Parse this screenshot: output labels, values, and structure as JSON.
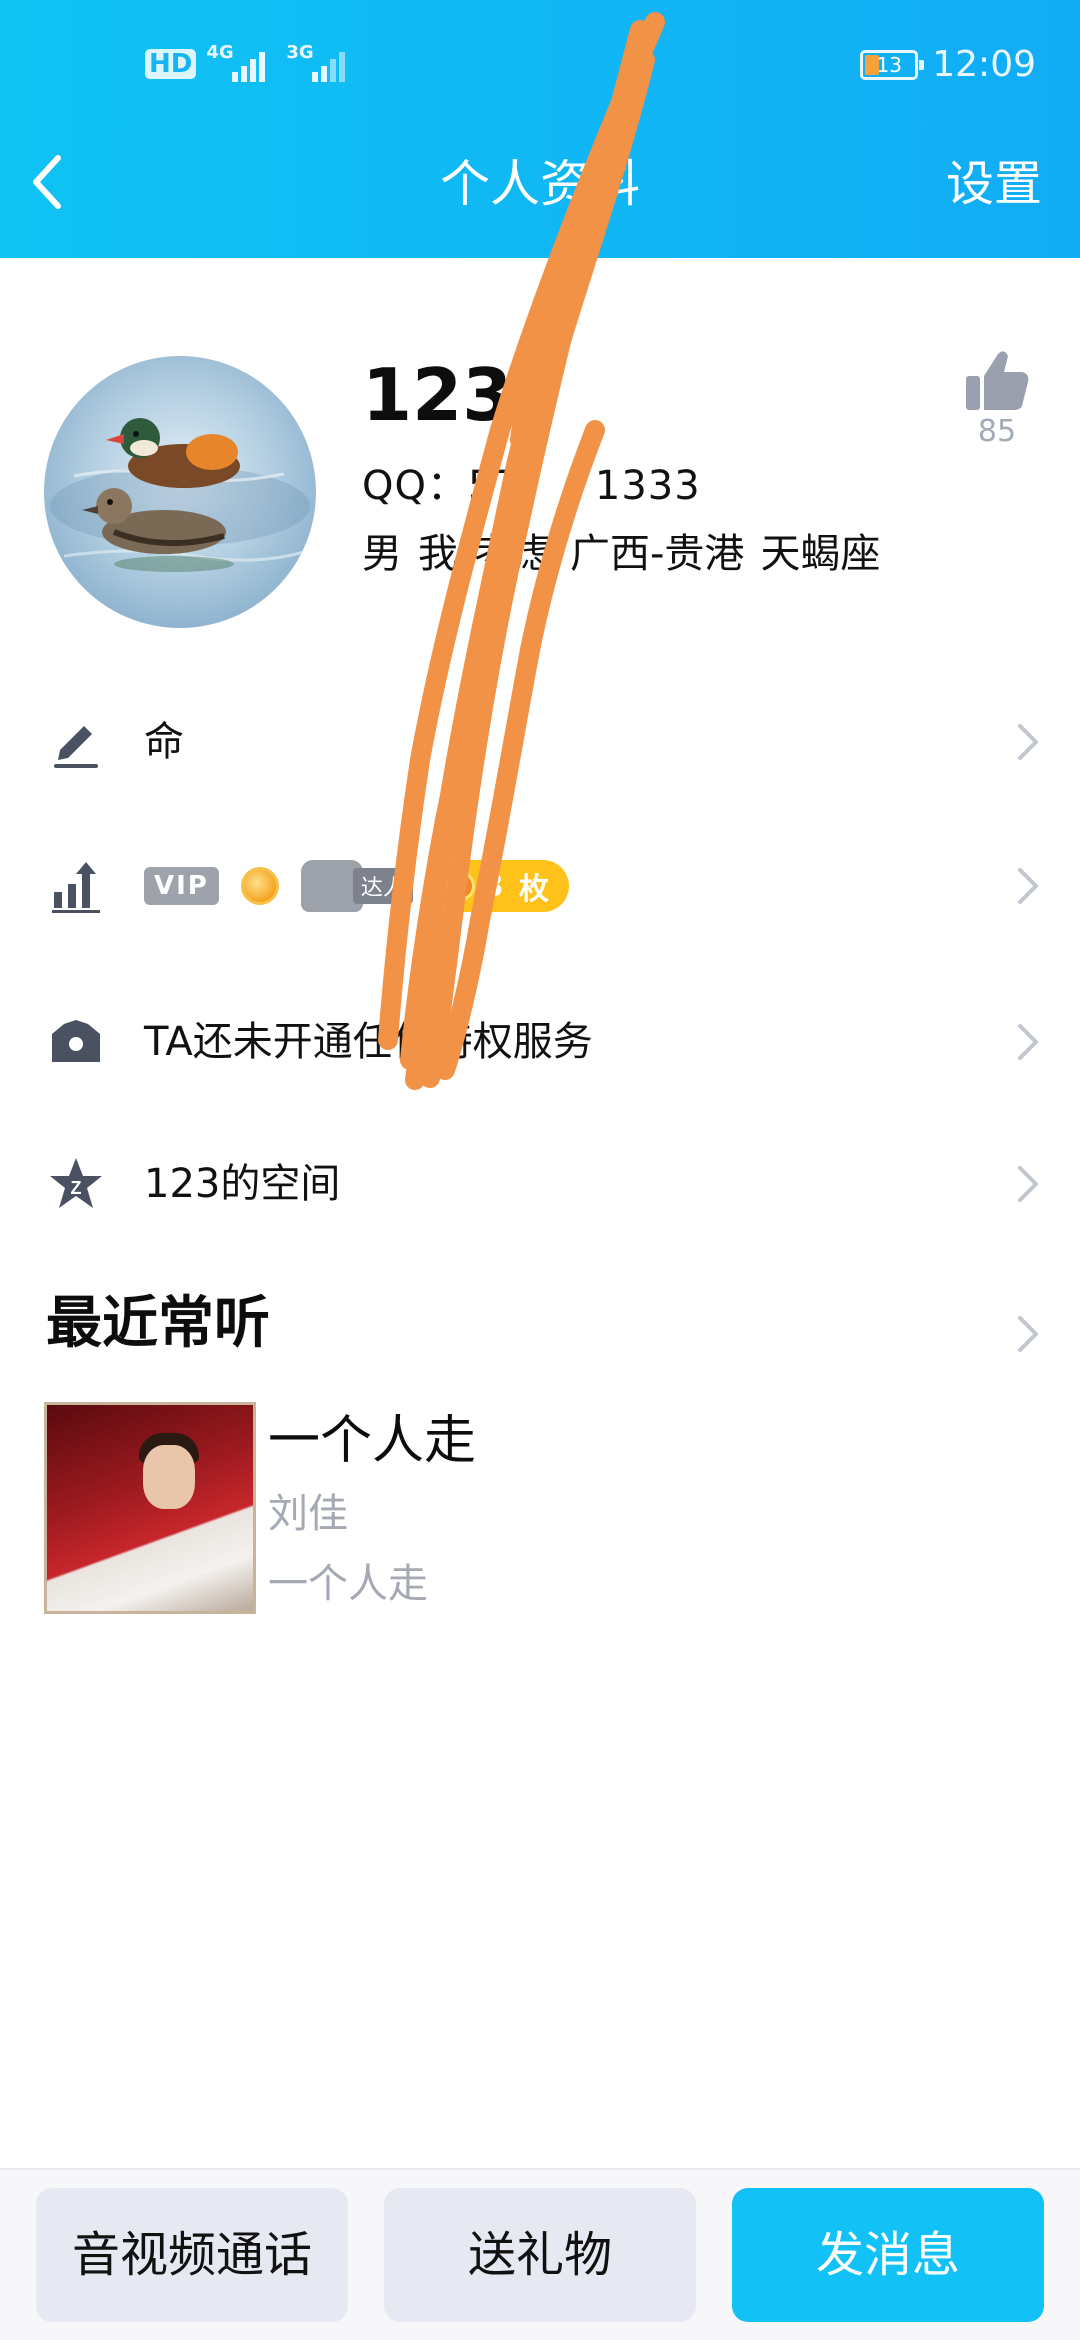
{
  "status_bar": {
    "hd_label": "HD",
    "sim1_network": "4G",
    "sim2_network": "3G",
    "battery_level": "13",
    "battery_percent": 13,
    "time": "12:09"
  },
  "header": {
    "title": "个人资料",
    "settings_label": "设置"
  },
  "profile": {
    "nickname": "123",
    "qq_label": "QQ：",
    "qq_number": "57",
    "qq_number_tail": "1333",
    "tags": [
      "男",
      "我",
      "考虑",
      "广西-贵港",
      "天蝎座"
    ],
    "like_count": "85"
  },
  "rows": {
    "signature": "命",
    "vip_badge": "VIP",
    "daren_label": "达人",
    "token_count": "3",
    "token_label": "枚",
    "privilege_text": "TA还未开通任何特权服务",
    "zone_text": "123的空间"
  },
  "recent": {
    "section_title": "最近常听",
    "song_title": "一个人走",
    "artist": "刘佳",
    "album": "一个人走"
  },
  "bottom_bar": {
    "av_call": "音视频通话",
    "send_gift": "送礼物",
    "send_message": "发消息"
  },
  "colors": {
    "header_gradient": [
      "#0fc3f3",
      "#12acf5"
    ],
    "primary": "#12c1f5",
    "scribble": "#f29247"
  }
}
